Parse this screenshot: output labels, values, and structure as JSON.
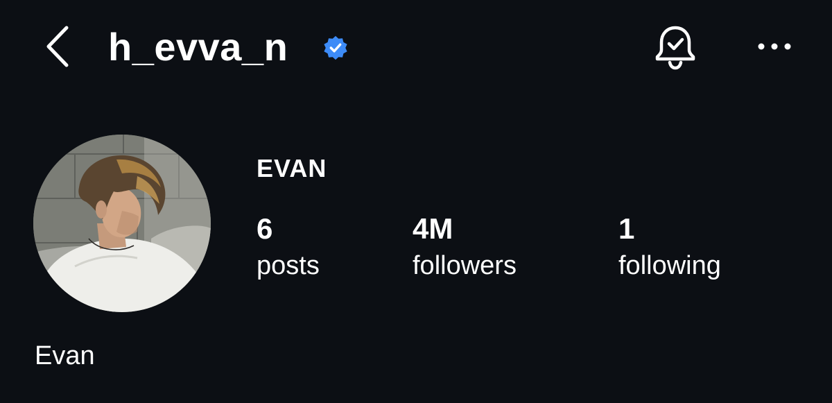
{
  "header": {
    "username": "h_evva_n",
    "back_icon": "chevron-left-icon",
    "verified_icon": "verified-badge-icon",
    "verified_color": "#3d8bf7",
    "notification_icon": "bell-check-icon",
    "more_icon": "more-horizontal-icon"
  },
  "profile": {
    "display_name": "EVAN",
    "avatar": "profile-photo",
    "bio_name": "Evan"
  },
  "stats": {
    "posts": {
      "value": "6",
      "label": "posts"
    },
    "followers": {
      "value": "4M",
      "label": "followers"
    },
    "following": {
      "value": "1",
      "label": "following"
    }
  },
  "colors": {
    "background": "#0c0f14",
    "text": "#ffffff"
  }
}
